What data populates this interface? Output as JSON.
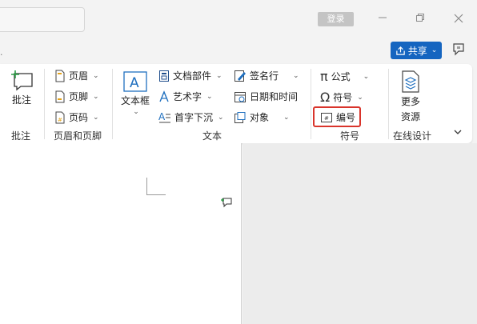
{
  "titlebar": {
    "login_label": "登录"
  },
  "share": {
    "label": "共享"
  },
  "ribbon": {
    "comment_group": {
      "comment_label": "批注",
      "group_label": "批注"
    },
    "header_footer_group": {
      "header_label": "页眉",
      "footer_label": "页脚",
      "page_number_label": "页码",
      "group_label": "页眉和页脚"
    },
    "text_group": {
      "text_box_label": "文本框",
      "quick_parts_label": "文档部件",
      "wordart_label": "艺术字",
      "drop_cap_label": "首字下沉",
      "signature_line_label": "签名行",
      "date_time_label": "日期和时间",
      "object_label": "对象",
      "group_label": "文本"
    },
    "symbols_group": {
      "equation_label": "公式",
      "symbol_label": "符号",
      "number_label": "编号",
      "group_label": "符号"
    },
    "online_design_group": {
      "more_resources_label_line1": "更多",
      "more_resources_label_line2": "资源",
      "group_label": "在线设计"
    }
  },
  "colors": {
    "accent": "#1565c0",
    "highlight_border": "#d9342b"
  }
}
